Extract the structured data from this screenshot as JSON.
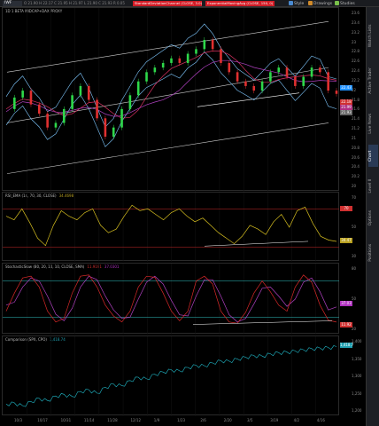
{
  "toolbar": {
    "symbol": "IWF",
    "style_label": "Style",
    "drawings_label": "Drawings",
    "studies_label": "Studies",
    "price_quote": "O 21.90 H 22.17 C 21.95 H 21.97 L 21.90 C 21.93 R 0.05",
    "study_badge_1": "StandardDeviationChannel (CLOSE, 3.0)",
    "study_badge_2": "ExponentialMovingAvg (CLOSE, 150, 0)"
  },
  "price_panel": {
    "title": "1D 1 BETA MIDCAP+DAX PROXY",
    "tags": [
      {
        "label": "22.43",
        "color": "#1e90ff"
      },
      {
        "label": "22.18",
        "color": "#d03030"
      },
      {
        "label": "21.99",
        "color": "#b03080"
      },
      {
        "label": "21.93",
        "color": "#666666"
      }
    ],
    "scale_ticks": [
      "23.6",
      "23.4",
      "23.2",
      "23",
      "22.8",
      "22.6",
      "22.4",
      "22.2",
      "22",
      "21.8",
      "21.6",
      "21.4",
      "21.2",
      "21",
      "20.8",
      "20.6",
      "20.4",
      "20.2",
      "20"
    ]
  },
  "rsi_panel": {
    "title": "RSI_EMA (14, 70, 30, CLOSE)",
    "value": "34.4698",
    "tags": [
      {
        "label": "70",
        "color": "#d03030"
      },
      {
        "label": "34.47",
        "color": "#b8a020"
      }
    ],
    "scale_ticks": [
      "70",
      "50",
      "30"
    ]
  },
  "stoch_panel": {
    "title": "StochasticSlow (80, 20, 10, 10, CLOSE, SMA)",
    "value_1": "11.9191",
    "value_2": "37.0301",
    "tags": [
      {
        "label": "37.03",
        "color": "#b030c0"
      },
      {
        "label": "11.92",
        "color": "#d03030"
      }
    ],
    "scale_ticks": [
      "80",
      "50",
      "20"
    ]
  },
  "comp_panel": {
    "title": "Comparison (SPX, CPO)",
    "value": "1,418.74",
    "tags": [
      {
        "label": "1,418.7",
        "color": "#20a0b0"
      }
    ],
    "scale_ticks": [
      "1,400",
      "1,350",
      "1,300",
      "1,250",
      "1,200"
    ]
  },
  "x_axis": {
    "labels": [
      "10/3",
      "10/17",
      "10/31",
      "11/14",
      "11/28",
      "12/12",
      "1/9",
      "1/23",
      "2/6",
      "2/20",
      "3/5",
      "3/19",
      "4/2",
      "4/16"
    ]
  },
  "sidebar": {
    "tabs": [
      "Watch Lists",
      "Active Trader",
      "Live News",
      "Chart",
      "Level II",
      "Options",
      "Positions"
    ]
  },
  "chart_data": [
    {
      "type": "line",
      "title": "Price with Bollinger bands and regression channel",
      "ylim": [
        20.0,
        23.6
      ],
      "close": [
        21.6,
        21.85,
        22.0,
        21.7,
        21.5,
        21.2,
        21.3,
        21.6,
        21.9,
        22.1,
        21.8,
        21.4,
        21.0,
        21.2,
        21.6,
        21.9,
        22.2,
        22.4,
        22.5,
        22.6,
        22.7,
        22.6,
        22.8,
        22.9,
        23.1,
        22.9,
        22.6,
        22.4,
        22.2,
        22.1,
        22.0,
        22.2,
        22.4,
        22.5,
        22.3,
        22.1,
        22.3,
        22.5,
        22.4,
        22.0,
        21.93
      ],
      "legend": []
    },
    {
      "type": "line",
      "title": "RSI_EMA",
      "ylim": [
        20,
        80
      ],
      "values": [
        62,
        58,
        70,
        55,
        38,
        30,
        52,
        68,
        62,
        58,
        66,
        70,
        52,
        44,
        48,
        62,
        74,
        68,
        70,
        64,
        58,
        66,
        70,
        62,
        56,
        60,
        52,
        44,
        38,
        32,
        40,
        52,
        48,
        42,
        56,
        64,
        50,
        68,
        72,
        54,
        40,
        36,
        34.47
      ]
    },
    {
      "type": "line",
      "title": "StochasticSlow",
      "ylim": [
        0,
        100
      ],
      "fullk": [
        30,
        60,
        85,
        88,
        70,
        30,
        12,
        18,
        60,
        88,
        90,
        70,
        40,
        22,
        12,
        30,
        70,
        88,
        86,
        60,
        30,
        14,
        30,
        80,
        88,
        75,
        30,
        12,
        10,
        28,
        60,
        80,
        62,
        40,
        30,
        70,
        90,
        78,
        40,
        15,
        11.92
      ],
      "fulld": [
        40,
        45,
        70,
        85,
        80,
        55,
        25,
        14,
        35,
        70,
        88,
        82,
        55,
        32,
        18,
        20,
        50,
        78,
        88,
        75,
        48,
        24,
        22,
        55,
        82,
        82,
        55,
        24,
        12,
        18,
        42,
        68,
        70,
        55,
        38,
        50,
        78,
        85,
        62,
        32,
        37.03
      ]
    },
    {
      "type": "line",
      "title": "Comparison",
      "ylim": [
        1200,
        1430
      ],
      "values": [
        1218,
        1222,
        1212,
        1226,
        1238,
        1230,
        1246,
        1252,
        1244,
        1262,
        1268,
        1256,
        1276,
        1288,
        1282,
        1300,
        1312,
        1306,
        1322,
        1330,
        1338,
        1334,
        1346,
        1354,
        1352,
        1362,
        1370,
        1368,
        1376,
        1382,
        1388,
        1386,
        1394,
        1398,
        1400,
        1404,
        1408,
        1412,
        1414,
        1416,
        1418.74
      ]
    }
  ]
}
